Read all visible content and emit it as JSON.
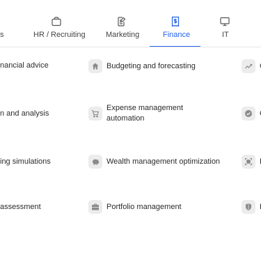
{
  "tabs": [
    {
      "label": "s",
      "active": false,
      "icon": "none"
    },
    {
      "label": "HR / Recruiting",
      "active": false,
      "icon": "briefcase-icon"
    },
    {
      "label": "Marketing",
      "active": false,
      "icon": "document-edit-icon"
    },
    {
      "label": "Finance",
      "active": true,
      "icon": "receipt-dollar-icon"
    },
    {
      "label": "IT",
      "active": false,
      "icon": "monitor-icon"
    }
  ],
  "colors": {
    "accent": "#2563eb",
    "icon_badge_bg": "#ececec",
    "icon_fg": "#8a8a8a"
  },
  "rows": [
    {
      "left": "nancial advice",
      "middle": {
        "label": "Budgeting and forecasting",
        "icon": "home-icon"
      },
      "right": {
        "label": "C",
        "icon": "trend-chart-icon"
      }
    },
    {
      "left": "n and analysis",
      "middle": {
        "label_line1": "Expense management",
        "label_line2": "automation",
        "icon": "cart-icon"
      },
      "right": {
        "label": "C",
        "icon": "check-circle-icon"
      }
    },
    {
      "left": "ing simulations",
      "middle": {
        "label": "Wealth management optimization",
        "icon": "piggy-bank-icon"
      },
      "right": {
        "label": "E",
        "icon": "frame-scan-icon"
      }
    },
    {
      "left": "assessment",
      "middle": {
        "label": "Portfolio management",
        "icon": "briefcase-icon"
      },
      "right": {
        "label": "F",
        "icon": "shield-icon"
      }
    }
  ]
}
